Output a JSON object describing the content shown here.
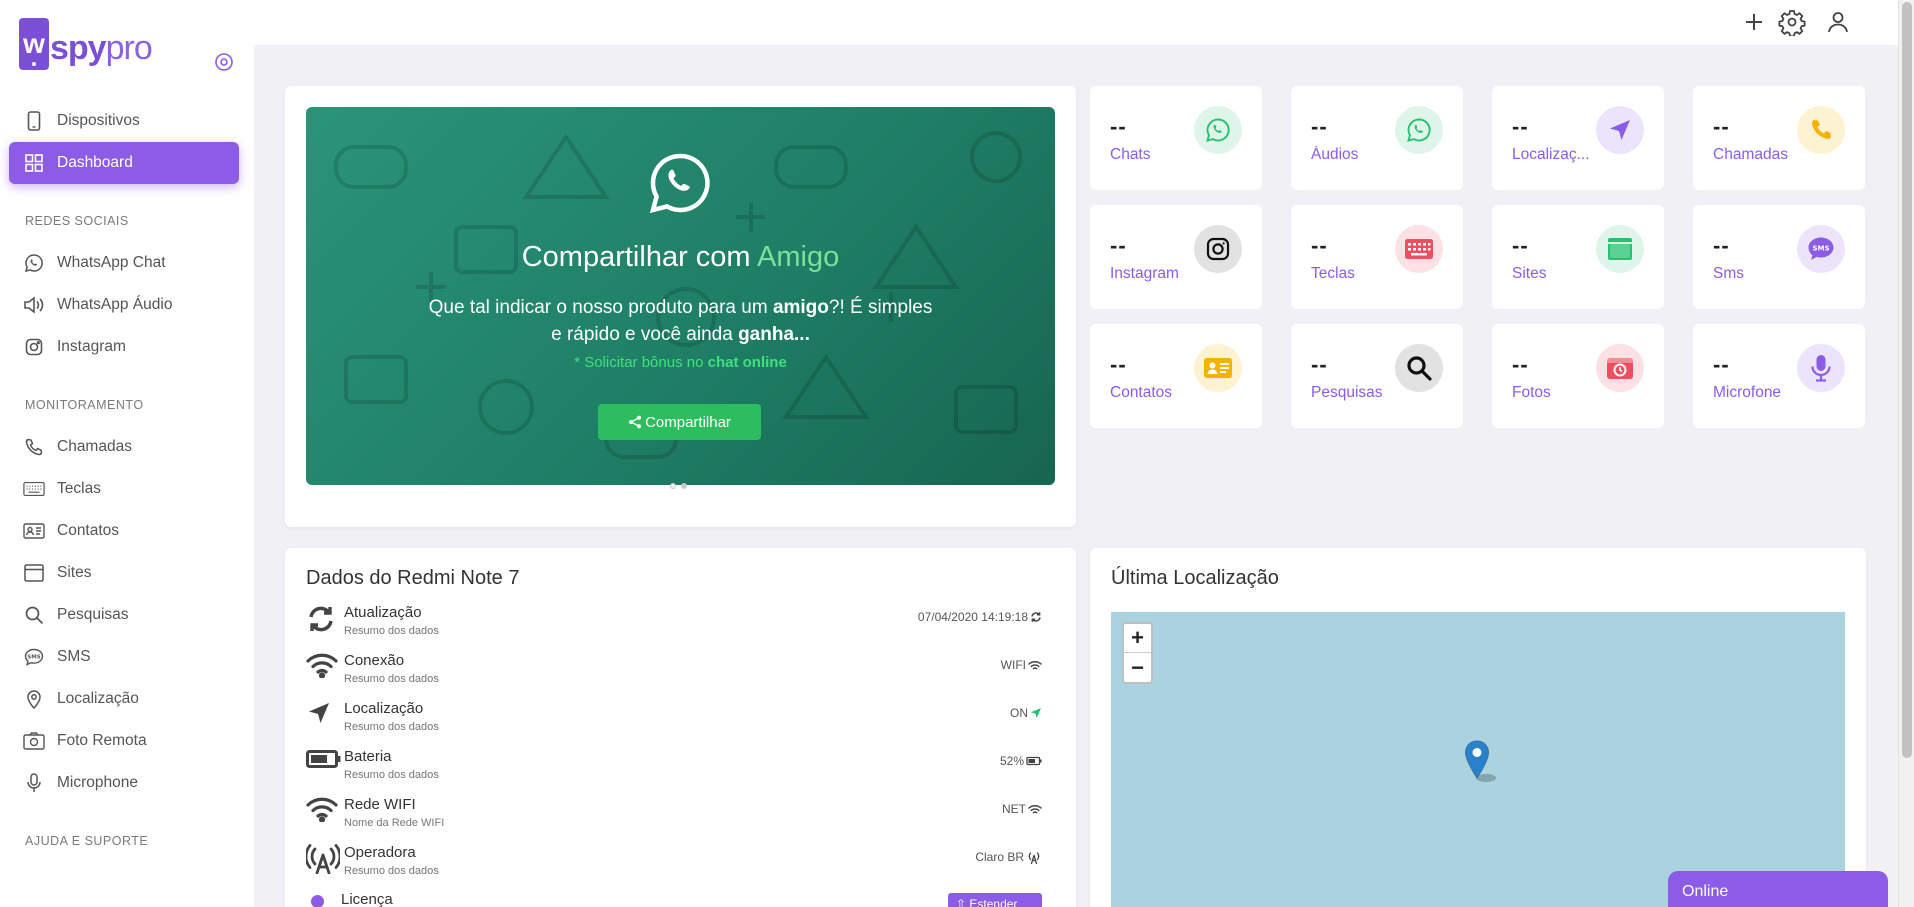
{
  "brand": {
    "w": "w",
    "spy": "spy",
    "pro": "pro"
  },
  "sidebar": {
    "items_top": [
      {
        "label": "Dispositivos",
        "icon": "phone-icon"
      },
      {
        "label": "Dashboard",
        "icon": "grid-icon"
      }
    ],
    "section_social": "REDES SOCIAIS",
    "items_social": [
      {
        "label": "WhatsApp Chat",
        "icon": "whatsapp-icon"
      },
      {
        "label": "WhatsApp Áudio",
        "icon": "speaker-icon"
      },
      {
        "label": "Instagram",
        "icon": "instagram-icon"
      }
    ],
    "section_monitor": "MONITORAMENTO",
    "items_monitor": [
      {
        "label": "Chamadas",
        "icon": "phone-call-icon"
      },
      {
        "label": "Teclas",
        "icon": "keyboard-icon"
      },
      {
        "label": "Contatos",
        "icon": "contact-card-icon"
      },
      {
        "label": "Sites",
        "icon": "browser-icon"
      },
      {
        "label": "Pesquisas",
        "icon": "search-icon"
      },
      {
        "label": "SMS",
        "icon": "sms-icon"
      },
      {
        "label": "Localização",
        "icon": "map-pin-icon"
      },
      {
        "label": "Foto Remota",
        "icon": "camera-icon"
      },
      {
        "label": "Microphone",
        "icon": "microphone-icon"
      }
    ],
    "section_help": "AJUDA E SUPORTE"
  },
  "promo": {
    "title_prefix": "Compartilhar com ",
    "title_highlight": "Amigo",
    "text_1": "Que tal indicar o nosso produto para um ",
    "text_b1": "amigo",
    "text_2": "?! É simples e rápido e você ainda ",
    "text_b2": "ganha...",
    "note_prefix": "* Solicitar bônus no ",
    "note_bold": "chat online",
    "button": "Compartilhar"
  },
  "stats": [
    {
      "value": "--",
      "label": "Chats",
      "icon": "whatsapp-icon",
      "color": "#25c16f",
      "bg": "#dff5e9"
    },
    {
      "value": "--",
      "label": "Áudios",
      "icon": "whatsapp-icon",
      "color": "#25c16f",
      "bg": "#dff5e9"
    },
    {
      "value": "--",
      "label": "Localizaç...",
      "icon": "navigation-arrow-icon",
      "color": "#8c5ce6",
      "bg": "#ece4fb"
    },
    {
      "value": "--",
      "label": "Chamadas",
      "icon": "phone-call-icon",
      "color": "#f5b300",
      "bg": "#fdf2d2"
    },
    {
      "value": "--",
      "label": "Instagram",
      "icon": "instagram-icon",
      "color": "#111111",
      "bg": "#e2e2e2"
    },
    {
      "value": "--",
      "label": "Teclas",
      "icon": "keyboard-icon",
      "color": "#ee4f5e",
      "bg": "#fde1e4"
    },
    {
      "value": "--",
      "label": "Sites",
      "icon": "browser-icon",
      "color": "#25c16f",
      "bg": "#dff5e9"
    },
    {
      "value": "--",
      "label": "Sms",
      "icon": "sms-icon",
      "color": "#8c5ce6",
      "bg": "#ece4fb"
    },
    {
      "value": "--",
      "label": "Contatos",
      "icon": "contact-card-icon",
      "color": "#f5b300",
      "bg": "#fdf2d2"
    },
    {
      "value": "--",
      "label": "Pesquisas",
      "icon": "search-icon",
      "color": "#111111",
      "bg": "#e2e2e2"
    },
    {
      "value": "--",
      "label": "Fotos",
      "icon": "camera-icon",
      "color": "#ee4f5e",
      "bg": "#fde1e4"
    },
    {
      "value": "--",
      "label": "Microfone",
      "icon": "microphone-icon",
      "color": "#8c5ce6",
      "bg": "#ece4fb"
    }
  ],
  "device": {
    "title": "Dados do Redmi Note 7",
    "rows": [
      {
        "name": "Atualização",
        "sub": "Resumo dos dados",
        "value": "07/04/2020 14:19:18",
        "icon": "refresh-icon"
      },
      {
        "name": "Conexão",
        "sub": "Resumo dos dados",
        "value": "WIFI",
        "icon": "wifi-icon"
      },
      {
        "name": "Localização",
        "sub": "Resumo dos dados",
        "value": "ON",
        "icon": "navigation-arrow-icon"
      },
      {
        "name": "Bateria",
        "sub": "Resumo dos dados",
        "value": "52%",
        "icon": "battery-icon"
      },
      {
        "name": "Rede WIFI",
        "sub": "Nome da Rede WIFI",
        "value": "NET",
        "icon": "wifi-icon"
      },
      {
        "name": "Operadora",
        "sub": "Resumo dos dados",
        "value": "Claro BR",
        "icon": "antenna-icon"
      }
    ],
    "license_label": "Licença",
    "license_btn": "⇧ Estender"
  },
  "location": {
    "title": "Última Localização",
    "zoom_in": "+",
    "zoom_out": "−"
  },
  "chat": {
    "label": "Online"
  },
  "colors": {
    "accent": "#8c5ce6",
    "green": "#25c16f"
  }
}
